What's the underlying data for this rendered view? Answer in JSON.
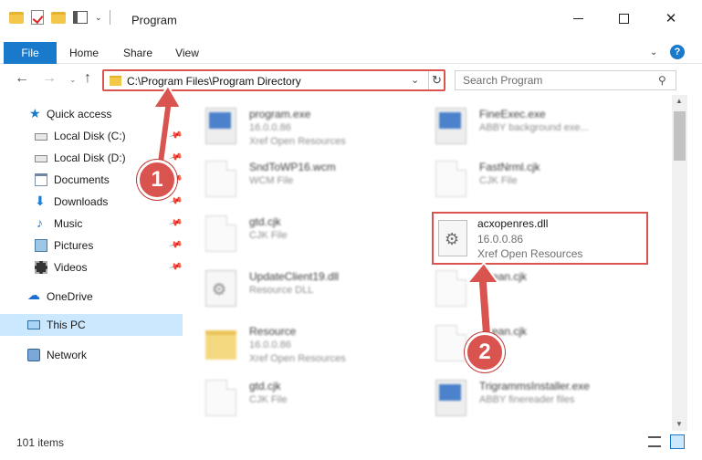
{
  "window": {
    "title": "Program",
    "minimize_icon": "minimize-icon",
    "maximize_icon": "maximize-icon",
    "close_symbol": "✕"
  },
  "ribbon": {
    "tabs": [
      "File",
      "Home",
      "Share",
      "View"
    ],
    "chevron": "⌄",
    "help": "?"
  },
  "nav": {
    "back": "←",
    "forward": "→",
    "history": "⌄",
    "up": "↑",
    "address": "C:\\Program Files\\Program Directory",
    "address_dropdown": "⌄",
    "refresh": "↻",
    "search_placeholder": "Search Program",
    "search_icon": "⚲"
  },
  "sidebar": {
    "items": [
      {
        "label": "Quick access",
        "icon": "star-icon"
      },
      {
        "label": "Local Disk (C:)",
        "icon": "disk-icon"
      },
      {
        "label": "Local Disk (D:)",
        "icon": "disk-icon"
      },
      {
        "label": "Documents",
        "icon": "documents-icon"
      },
      {
        "label": "Downloads",
        "icon": "download-icon"
      },
      {
        "label": "Music",
        "icon": "music-icon"
      },
      {
        "label": "Pictures",
        "icon": "pictures-icon"
      },
      {
        "label": "Videos",
        "icon": "videos-icon"
      },
      {
        "label": "OneDrive",
        "icon": "cloud-icon"
      },
      {
        "label": "This PC",
        "icon": "computer-icon"
      },
      {
        "label": "Network",
        "icon": "network-icon"
      }
    ],
    "pin": "📌",
    "star": "★",
    "download": "⬇",
    "music": "♪",
    "cloud": "☁"
  },
  "files": [
    {
      "name": "program.exe",
      "meta1": "16.0.0.86",
      "meta2": "Xref Open Resources",
      "kind": "exe"
    },
    {
      "name": "FineExec.exe",
      "meta1": "ABBY background exe...",
      "meta2": "",
      "kind": "exe"
    },
    {
      "name": "SndToWP16.wcm",
      "meta1": "WCM File",
      "meta2": "",
      "kind": "doc"
    },
    {
      "name": "FastNrml.cjk",
      "meta1": "CJK File",
      "meta2": "",
      "kind": "doc"
    },
    {
      "name": "gtd.cjk",
      "meta1": "CJK File",
      "meta2": "",
      "kind": "doc"
    },
    {
      "name": "UpdateClient19.dll",
      "meta1": "Resource DLL",
      "meta2": "",
      "kind": "gear"
    },
    {
      "name": "...rean.cjk",
      "meta1": "",
      "meta2": "",
      "kind": "doc"
    },
    {
      "name": "Resource",
      "meta1": "16.0.0.86",
      "meta2": "Xref Open Resources",
      "kind": "folder"
    },
    {
      "name": "...rean.cjk",
      "meta1": "",
      "meta2": "",
      "kind": "doc"
    },
    {
      "name": "gtd.cjk",
      "meta1": "CJK File",
      "meta2": "",
      "kind": "doc"
    },
    {
      "name": "TrigrammsInstaller.exe",
      "meta1": "ABBY finereader files",
      "meta2": "",
      "kind": "exe"
    }
  ],
  "highlighted_file": {
    "name": "acxopenres.dll",
    "version": "16.0.0.86",
    "description": "Xref Open Resources"
  },
  "scrollbar": {
    "up": "▲",
    "down": "▼"
  },
  "status": {
    "count": "101 items"
  },
  "annotations": {
    "step1": "1",
    "step2": "2",
    "color": "#d9534f"
  }
}
